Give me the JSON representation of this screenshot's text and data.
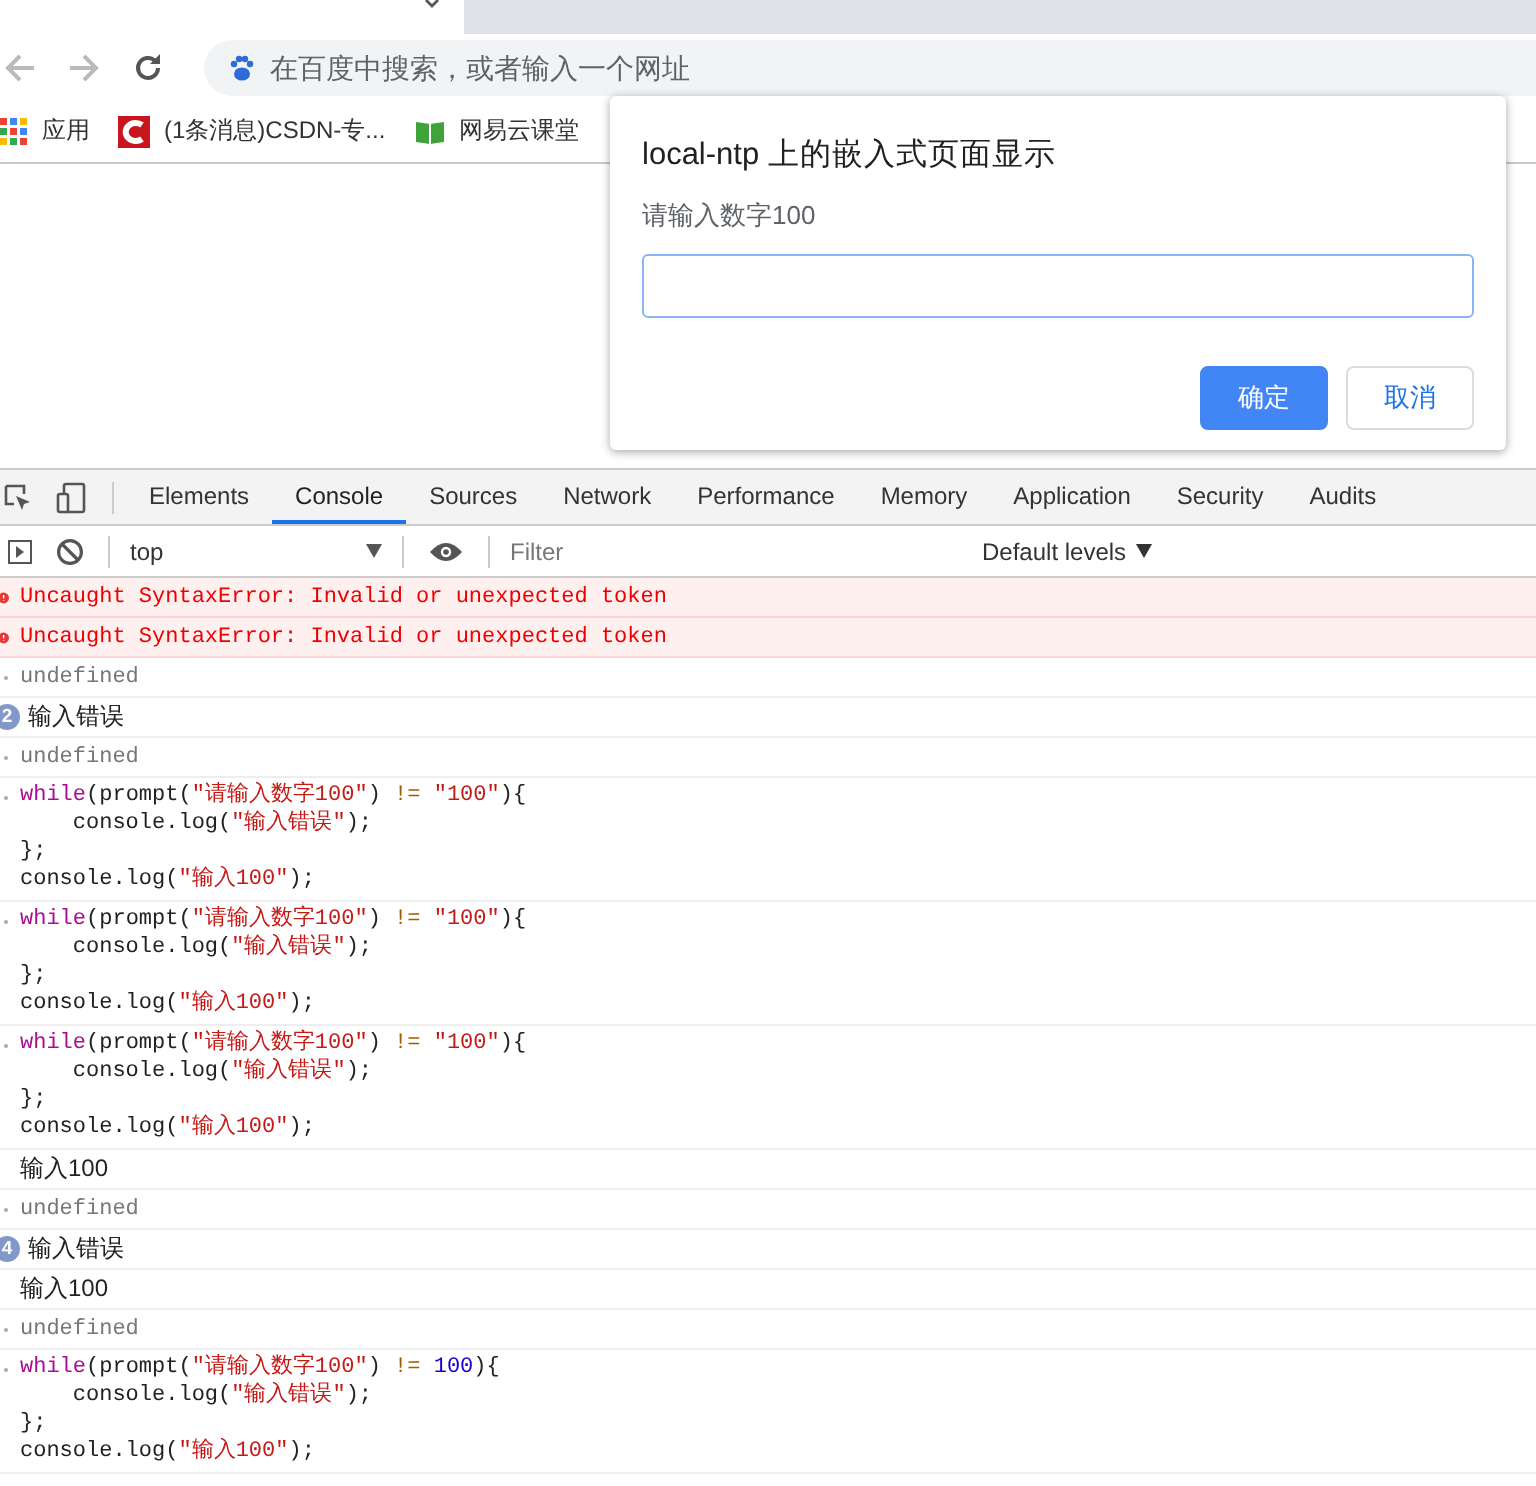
{
  "omnibox": {
    "placeholder": "在百度中搜索，或者输入一个网址"
  },
  "bookmarks": [
    {
      "label": "应用",
      "kind": "apps"
    },
    {
      "label": "(1条消息)CSDN-专...",
      "kind": "csdn"
    },
    {
      "label": "网易云课堂",
      "kind": "book"
    }
  ],
  "dialog": {
    "title": "local-ntp 上的嵌入式页面显示",
    "message": "请输入数字100",
    "buttons": [
      {
        "label": "确定",
        "primary": true
      },
      {
        "label": "取消",
        "primary": false
      }
    ]
  },
  "devtools": {
    "tabs": [
      {
        "label": "Elements",
        "selected": false
      },
      {
        "label": "Console",
        "selected": true
      },
      {
        "label": "Sources",
        "selected": false
      },
      {
        "label": "Network",
        "selected": false
      },
      {
        "label": "Performance",
        "selected": false
      },
      {
        "label": "Memory",
        "selected": false
      },
      {
        "label": "Application",
        "selected": false
      },
      {
        "label": "Security",
        "selected": false
      },
      {
        "label": "Audits",
        "selected": false
      }
    ],
    "context": "top",
    "filter": {
      "placeholder": "Filter"
    },
    "levels": "Default levels",
    "messages": [
      {
        "kind": "error",
        "text": "Uncaught SyntaxError: Invalid or unexpected token"
      },
      {
        "kind": "error",
        "text": "Uncaught SyntaxError: Invalid or unexpected token"
      },
      {
        "kind": "result",
        "text": "undefined"
      },
      {
        "kind": "log",
        "count": "2",
        "text": "输入错误"
      },
      {
        "kind": "result",
        "text": "undefined"
      },
      {
        "kind": "code",
        "lines": [
          [
            {
              "kind": "keyword",
              "text": "while"
            },
            {
              "kind": "plain",
              "text": "(prompt("
            },
            {
              "kind": "string",
              "text": "\"请输入数字100\""
            },
            {
              "kind": "plain",
              "text": ") "
            },
            {
              "kind": "operator",
              "text": "!= "
            },
            {
              "kind": "string",
              "text": "\"100\""
            },
            {
              "kind": "plain",
              "text": "){"
            }
          ],
          [
            {
              "kind": "plain",
              "text": "    console.log("
            },
            {
              "kind": "string",
              "text": "\"输入错误\""
            },
            {
              "kind": "plain",
              "text": ");"
            }
          ],
          [
            {
              "kind": "plain",
              "text": "};"
            }
          ],
          [
            {
              "kind": "plain",
              "text": "console.log("
            },
            {
              "kind": "string",
              "text": "\"输入100\""
            },
            {
              "kind": "plain",
              "text": ");"
            }
          ]
        ]
      },
      {
        "kind": "code",
        "lines": [
          [
            {
              "kind": "keyword",
              "text": "while"
            },
            {
              "kind": "plain",
              "text": "(prompt("
            },
            {
              "kind": "string",
              "text": "\"请输入数字100\""
            },
            {
              "kind": "plain",
              "text": ") "
            },
            {
              "kind": "operator",
              "text": "!= "
            },
            {
              "kind": "string",
              "text": "\"100\""
            },
            {
              "kind": "plain",
              "text": "){"
            }
          ],
          [
            {
              "kind": "plain",
              "text": "    console.log("
            },
            {
              "kind": "string",
              "text": "\"输入错误\""
            },
            {
              "kind": "plain",
              "text": ");"
            }
          ],
          [
            {
              "kind": "plain",
              "text": "};"
            }
          ],
          [
            {
              "kind": "plain",
              "text": "console.log("
            },
            {
              "kind": "string",
              "text": "\"输入100\""
            },
            {
              "kind": "plain",
              "text": ");"
            }
          ]
        ]
      },
      {
        "kind": "code",
        "lines": [
          [
            {
              "kind": "keyword",
              "text": "while"
            },
            {
              "kind": "plain",
              "text": "(prompt("
            },
            {
              "kind": "string",
              "text": "\"请输入数字100\""
            },
            {
              "kind": "plain",
              "text": ") "
            },
            {
              "kind": "operator",
              "text": "!= "
            },
            {
              "kind": "string",
              "text": "\"100\""
            },
            {
              "kind": "plain",
              "text": "){"
            }
          ],
          [
            {
              "kind": "plain",
              "text": "    console.log("
            },
            {
              "kind": "string",
              "text": "\"输入错误\""
            },
            {
              "kind": "plain",
              "text": ");"
            }
          ],
          [
            {
              "kind": "plain",
              "text": "};"
            }
          ],
          [
            {
              "kind": "plain",
              "text": "console.log("
            },
            {
              "kind": "string",
              "text": "\"输入100\""
            },
            {
              "kind": "plain",
              "text": ");"
            }
          ]
        ]
      },
      {
        "kind": "log",
        "text": "输入100"
      },
      {
        "kind": "result",
        "text": "undefined"
      },
      {
        "kind": "log",
        "count": "4",
        "text": "输入错误"
      },
      {
        "kind": "log",
        "text": "输入100"
      },
      {
        "kind": "result",
        "text": "undefined"
      },
      {
        "kind": "code",
        "lines": [
          [
            {
              "kind": "keyword",
              "text": "while"
            },
            {
              "kind": "plain",
              "text": "(prompt("
            },
            {
              "kind": "string",
              "text": "\"请输入数字100\""
            },
            {
              "kind": "plain",
              "text": ") "
            },
            {
              "kind": "operator",
              "text": "!= "
            },
            {
              "kind": "number",
              "text": "100"
            },
            {
              "kind": "plain",
              "text": "){"
            }
          ],
          [
            {
              "kind": "plain",
              "text": "    console.log("
            },
            {
              "kind": "string",
              "text": "\"输入错误\""
            },
            {
              "kind": "plain",
              "text": ");"
            }
          ],
          [
            {
              "kind": "plain",
              "text": "};"
            }
          ],
          [
            {
              "kind": "plain",
              "text": "console.log("
            },
            {
              "kind": "string",
              "text": "\"输入100\""
            },
            {
              "kind": "plain",
              "text": ");"
            }
          ]
        ]
      }
    ]
  }
}
